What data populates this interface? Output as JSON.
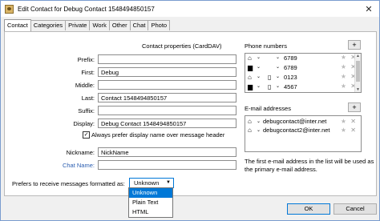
{
  "window": {
    "title": "Edit Contact for Debug Contact 1548494850157",
    "close_glyph": "✕"
  },
  "tabs": [
    {
      "label": "Contact"
    },
    {
      "label": "Categories"
    },
    {
      "label": "Private"
    },
    {
      "label": "Work"
    },
    {
      "label": "Other"
    },
    {
      "label": "Chat"
    },
    {
      "label": "Photo"
    }
  ],
  "contact": {
    "section_title": "Contact properties (CardDAV)",
    "prefix_label": "Prefix:",
    "prefix_value": "",
    "first_label": "First:",
    "first_value": "Debug",
    "middle_label": "Middle:",
    "middle_value": "",
    "last_label": "Last:",
    "last_value": "Contact 1548494850157",
    "suffix_label": "Suffix:",
    "suffix_value": "",
    "display_label": "Display:",
    "display_value": "Debug Contact 1548494850157",
    "always_prefer_label": "Always prefer display name over message header",
    "always_prefer_checked": true,
    "nickname_label": "Nickname:",
    "nickname_value": "NickName",
    "chatname_label": "Chat Name:",
    "chatname_value": ""
  },
  "phones": {
    "title": "Phone numbers",
    "add_label": "+",
    "items": [
      {
        "number": "6789"
      },
      {
        "number": "6789"
      },
      {
        "number": "0123"
      },
      {
        "number": "4567"
      }
    ]
  },
  "emails": {
    "title": "E-mail addresses",
    "add_label": "+",
    "items": [
      {
        "address": "debugcontact@inter.net"
      },
      {
        "address": "debugcontact2@inter.net"
      }
    ],
    "note": "The first e-mail address in the list will be used as the primary e-mail address."
  },
  "format": {
    "label": "Prefers to receive messages formatted as:",
    "selected": "Unknown",
    "options": [
      "Unknown",
      "Plain Text",
      "HTML"
    ]
  },
  "buttons": {
    "ok": "OK",
    "cancel": "Cancel"
  },
  "icons": {
    "star": "★",
    "remove": "✕",
    "chevron": "⌄"
  }
}
